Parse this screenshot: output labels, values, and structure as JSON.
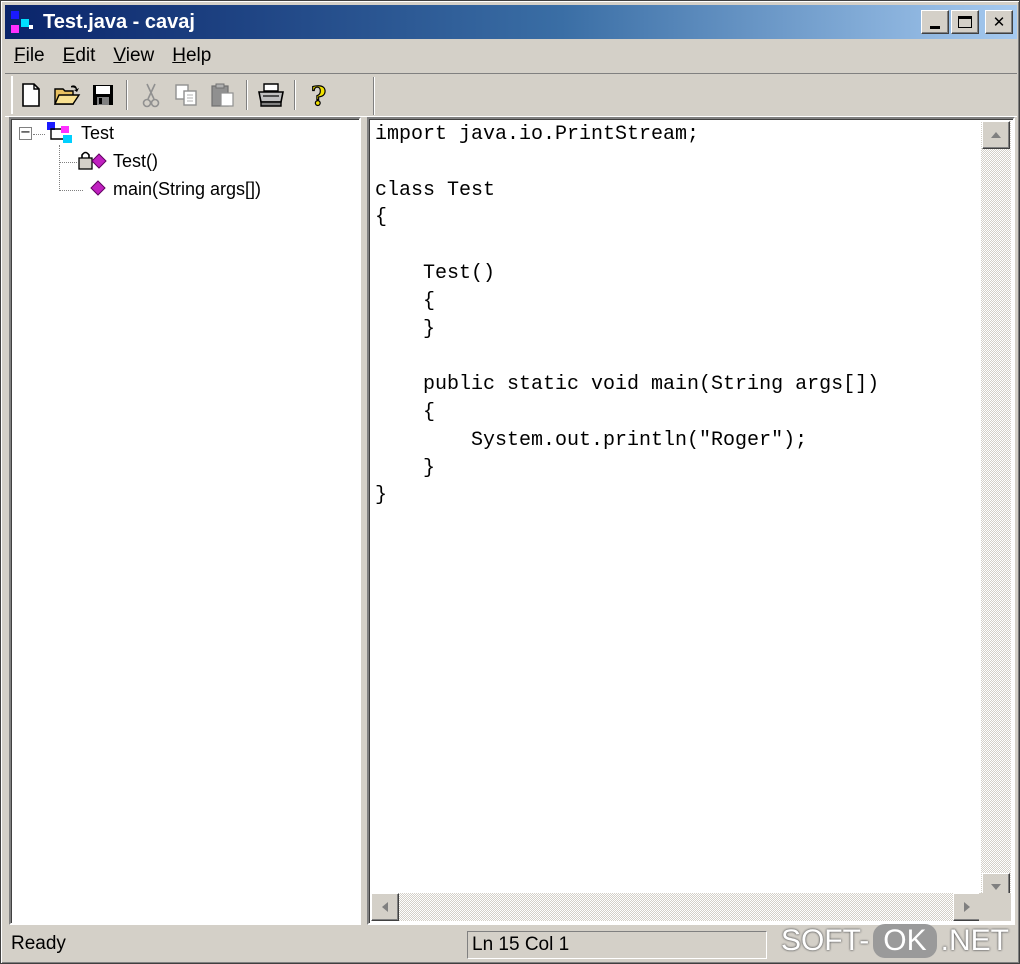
{
  "window": {
    "title": "Test.java - cavaj",
    "minimize_label": "_",
    "maximize_label": "□",
    "close_label": "✕"
  },
  "menu": {
    "items": [
      {
        "accel": "F",
        "rest": "ile"
      },
      {
        "accel": "E",
        "rest": "dit"
      },
      {
        "accel": "V",
        "rest": "iew"
      },
      {
        "accel": "H",
        "rest": "elp"
      }
    ]
  },
  "toolbar": {
    "icons": [
      "new-file-icon",
      "open-folder-icon",
      "save-icon",
      "cut-icon",
      "copy-icon",
      "paste-icon",
      "print-icon",
      "help-icon"
    ]
  },
  "tree": {
    "root": "Test",
    "children": [
      "Test()",
      "main(String args[])"
    ],
    "expander": "−"
  },
  "editor": {
    "code": "import java.io.PrintStream;\n\nclass Test\n{\n\n    Test()\n    {\n    }\n\n    public static void main(String args[])\n    {\n        System.out.println(\"Roger\");\n    }\n}"
  },
  "status": {
    "message": "Ready",
    "position": "Ln 15 Col 1"
  },
  "watermark": {
    "left": "SOFT-",
    "pill": "OK",
    "right": ".NET"
  },
  "colors": {
    "titlebar_start": "#0a246a",
    "titlebar_end": "#a6caf0",
    "chrome": "#d4d0c8",
    "method_icon": "#c020c0"
  }
}
